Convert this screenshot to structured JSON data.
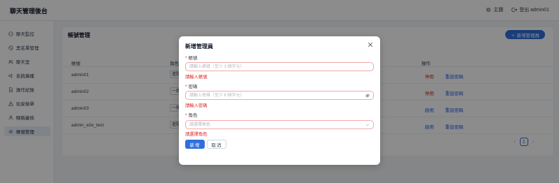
{
  "header": {
    "title": "聊天管理後台",
    "theme_label": "主題",
    "logout_label": "登出 admin01"
  },
  "sidebar": {
    "items": [
      {
        "label": "聊天監控",
        "icon": "chat-bubble-icon"
      },
      {
        "label": "黑名單管理",
        "icon": "block-icon"
      },
      {
        "label": "聊天室",
        "icon": "users-icon"
      },
      {
        "label": "系統廣播",
        "icon": "broadcast-icon"
      },
      {
        "label": "操作紀錄",
        "icon": "document-icon"
      },
      {
        "label": "玩家檢舉",
        "icon": "warning-icon"
      },
      {
        "label": "暱稱審核",
        "icon": "user-icon"
      },
      {
        "label": "帳號管理",
        "icon": "gear-icon"
      }
    ],
    "active_index": 7
  },
  "main": {
    "title": "帳號管理",
    "add_button": "新增管理員",
    "columns": [
      "帳號",
      "角色",
      "操作"
    ],
    "rows": [
      {
        "username": "admin01",
        "role": "進階",
        "action": "停用",
        "action_color": "#dc2626",
        "reset": "重設密碼"
      },
      {
        "username": "admin02",
        "role": "一般",
        "action": "停用",
        "action_color": "#dc2626",
        "reset": "重設密碼"
      },
      {
        "username": "admin03",
        "role": "一般",
        "action": "啟用",
        "action_color": "#2563eb",
        "reset": "重設密碼"
      },
      {
        "username": "admin_e2e_test",
        "role": "進階",
        "action": "啟用",
        "action_color": "#2563eb",
        "reset": "重設密碼"
      }
    ],
    "pagination": {
      "current": "1",
      "prev": "‹",
      "next": "›"
    }
  },
  "modal": {
    "title": "新增管理員",
    "fields": [
      {
        "label": "帳號",
        "placeholder": "請輸入帳號（至少 3 個字元）",
        "error": "請輸入帳號"
      },
      {
        "label": "密碼",
        "placeholder": "請輸入密碼（至少 6 個字元）",
        "error": "請輸入密碼"
      },
      {
        "label": "角色",
        "placeholder": "請選擇角色",
        "error": "請選擇角色"
      }
    ],
    "required_mark": "*",
    "submit_label": "新增",
    "cancel_label": "取消"
  }
}
